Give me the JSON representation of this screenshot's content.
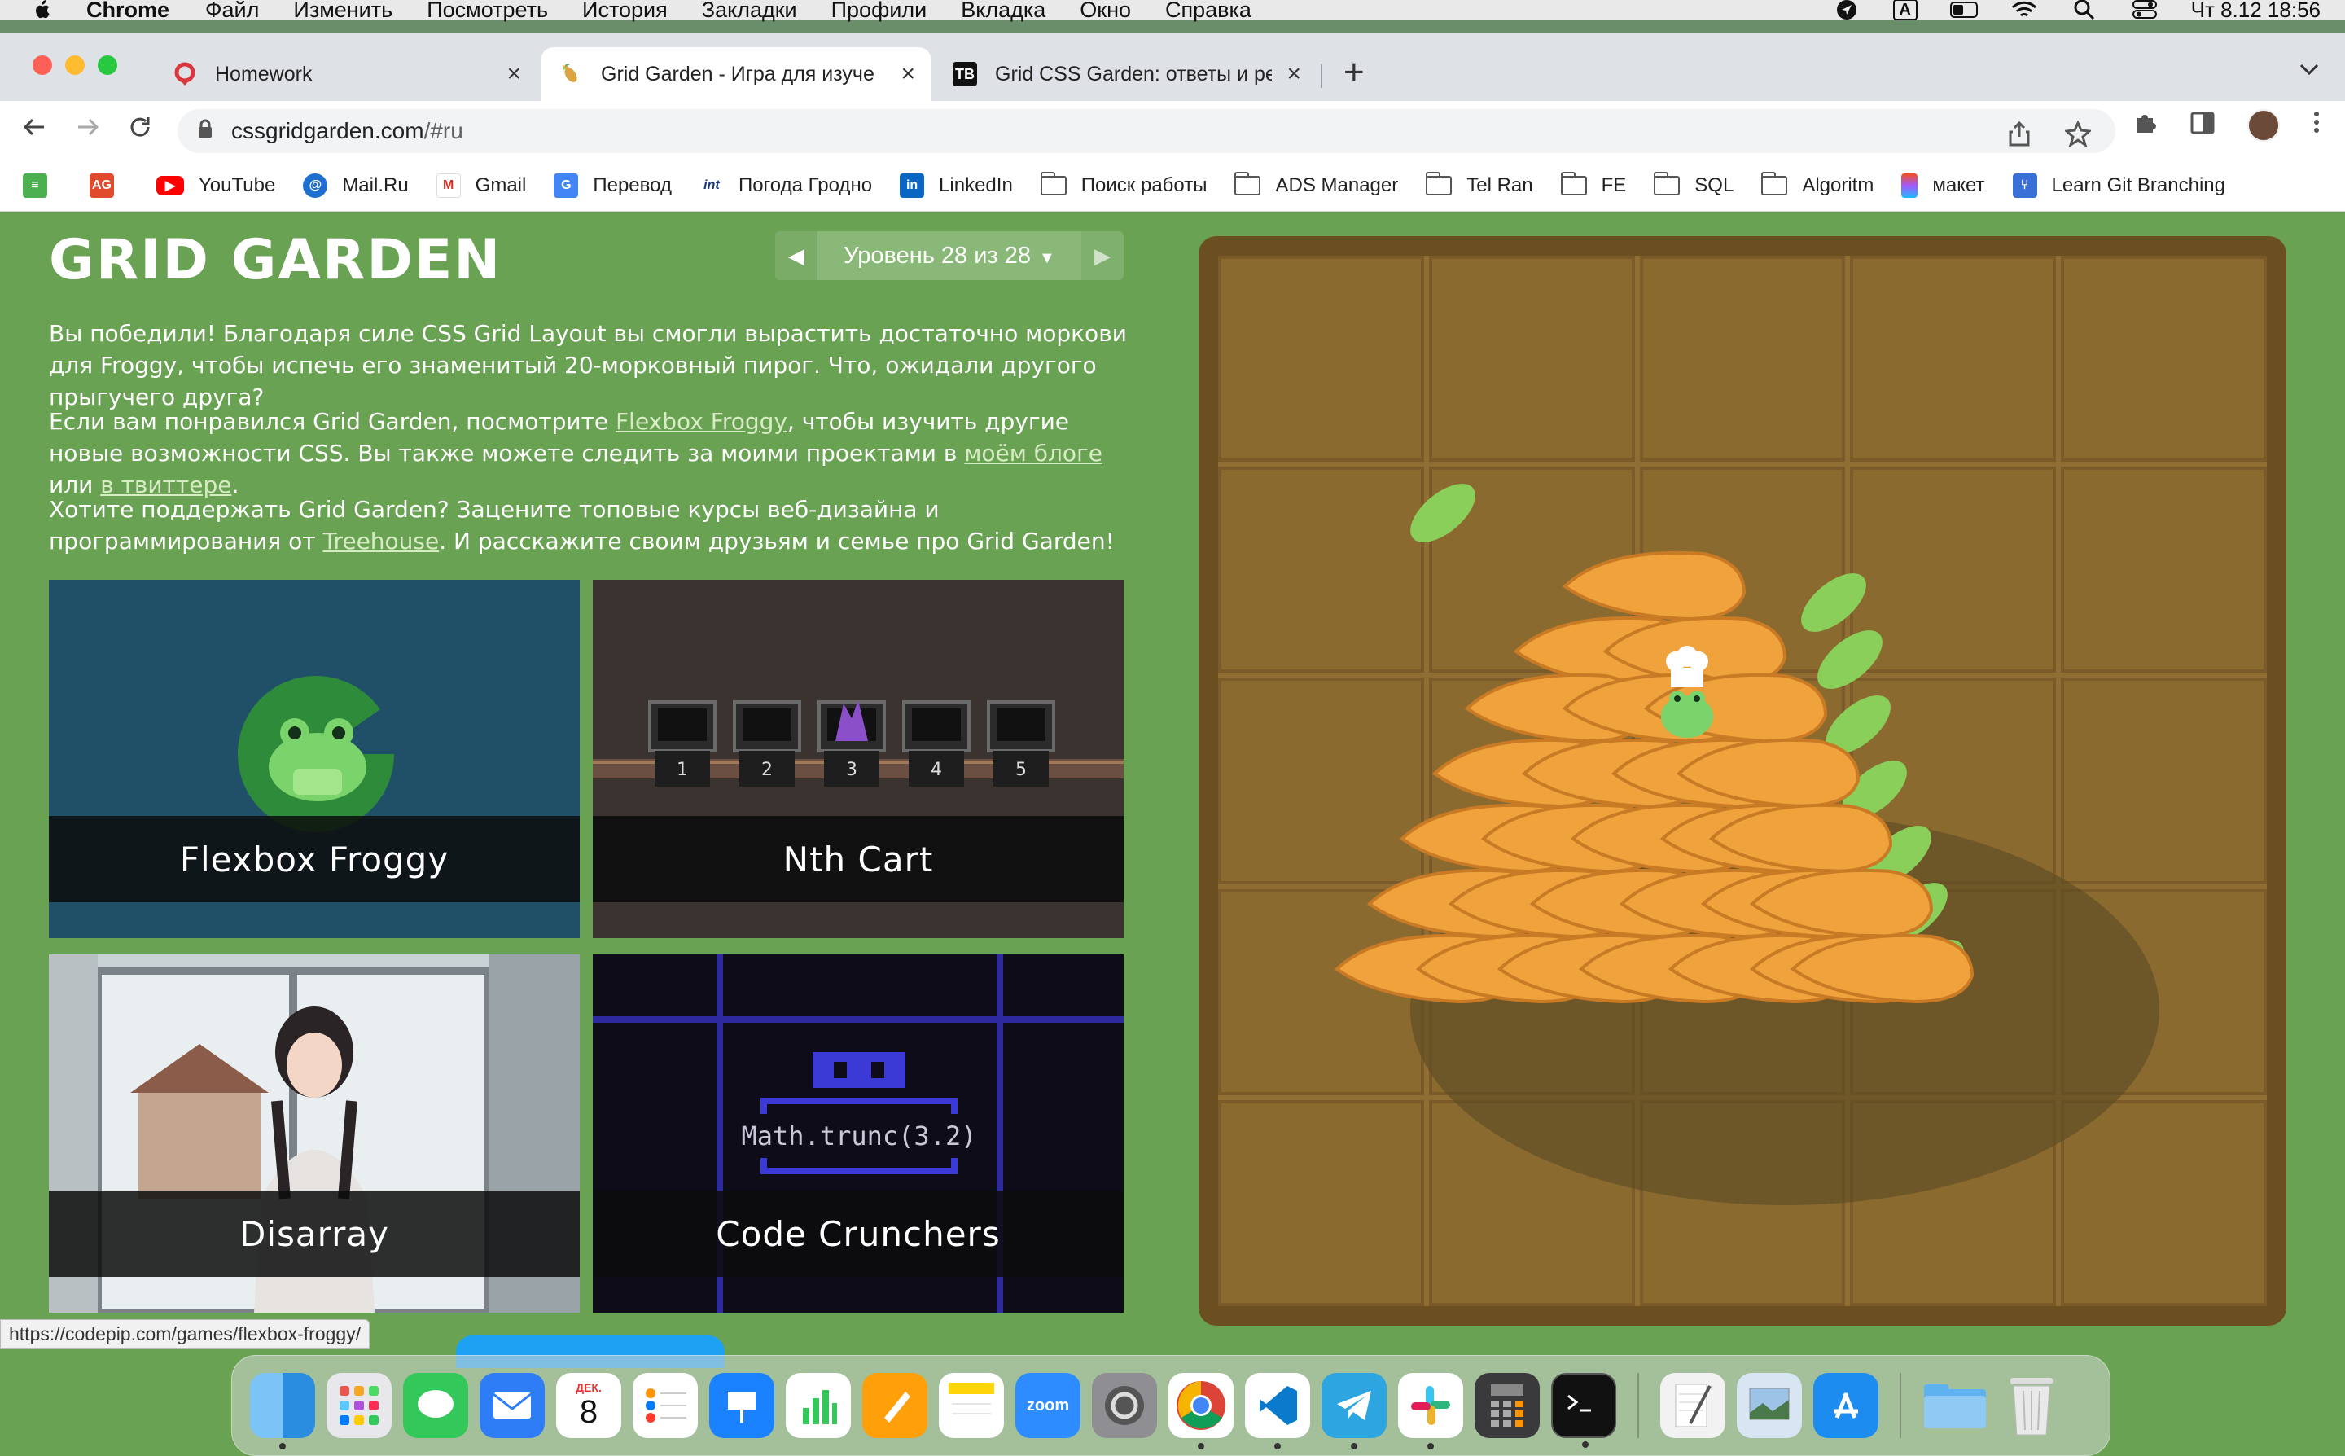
{
  "menubar": {
    "app": "Chrome",
    "items": [
      "Файл",
      "Изменить",
      "Посмотреть",
      "История",
      "Закладки",
      "Профили",
      "Вкладка",
      "Окно",
      "Справка"
    ],
    "keyboard": "A",
    "clock": "Чт 8.12  18:56"
  },
  "tabs": [
    {
      "title": "Homework",
      "favicon": "homework-icon"
    },
    {
      "title": "Grid Garden - Игра для изуче",
      "favicon": "carrot-icon"
    },
    {
      "title": "Grid CSS Garden: ответы и ре",
      "favicon": "tb-icon"
    }
  ],
  "omnibox": {
    "host": "cssgridgarden.com",
    "path": "/#ru"
  },
  "bookmarks": [
    {
      "label": "",
      "icon": "rss-icon"
    },
    {
      "label": "",
      "icon": "ag-icon"
    },
    {
      "label": "YouTube",
      "icon": "youtube-icon"
    },
    {
      "label": "Mail.Ru",
      "icon": "mailru-icon"
    },
    {
      "label": "Gmail",
      "icon": "gmail-icon"
    },
    {
      "label": "Перевод",
      "icon": "translate-icon"
    },
    {
      "label": "Погода Гродно",
      "icon": "weather-icon"
    },
    {
      "label": "LinkedIn",
      "icon": "linkedin-icon"
    },
    {
      "label": "Поиск работы",
      "icon": "folder-icon"
    },
    {
      "label": "ADS Manager",
      "icon": "folder-icon"
    },
    {
      "label": "Tel Ran",
      "icon": "folder-icon"
    },
    {
      "label": "FE",
      "icon": "folder-icon"
    },
    {
      "label": "SQL",
      "icon": "folder-icon"
    },
    {
      "label": "Algoritm",
      "icon": "folder-icon"
    },
    {
      "label": "макет",
      "icon": "figma-icon"
    },
    {
      "label": "Learn Git Branching",
      "icon": "git-icon"
    }
  ],
  "page": {
    "title": "GRID GARDEN",
    "level": "Уровень 28 из 28",
    "p1": "Вы победили! Благодаря силе CSS Grid Layout вы смогли вырастить достаточно моркови для Froggy, чтобы испечь его знаменитый 20-морковный пирог. Что, ожидали другого прыгучего друга?",
    "p2_a": "Если вам понравился Grid Garden, посмотрите ",
    "p2_link1": "Flexbox Froggy",
    "p2_b": ", чтобы изучить другие новые возможности CSS. Вы также можете следить за моими проектами в ",
    "p2_link2": "моём блоге",
    "p2_c": " или ",
    "p2_link3": "в твиттере",
    "p2_d": ".",
    "p3_a": "Хотите поддержать Grid Garden? Зацените топовые курсы веб-дизайна и программирования от ",
    "p3_link": "Treehouse",
    "p3_b": ". И расскажите своим друзьям и семье про Grid Garden!",
    "cards": [
      "Flexbox Froggy",
      "Nth Cart",
      "Disarray",
      "Code Crunchers"
    ],
    "cart_numbers": [
      "1",
      "2",
      "3",
      "4",
      "5"
    ],
    "code_text": "Math.trunc(3.2)"
  },
  "status_url": "https://codepip.com/games/flexbox-froggy/",
  "dock": {
    "calendar_month": "ДЕК.",
    "calendar_day": "8",
    "zoom": "zoom"
  },
  "colors": {
    "page_bg": "#6aa253",
    "garden_soil": "#8b6a30",
    "carrot": "#f0a23c",
    "leaf": "#8bcf5b"
  }
}
